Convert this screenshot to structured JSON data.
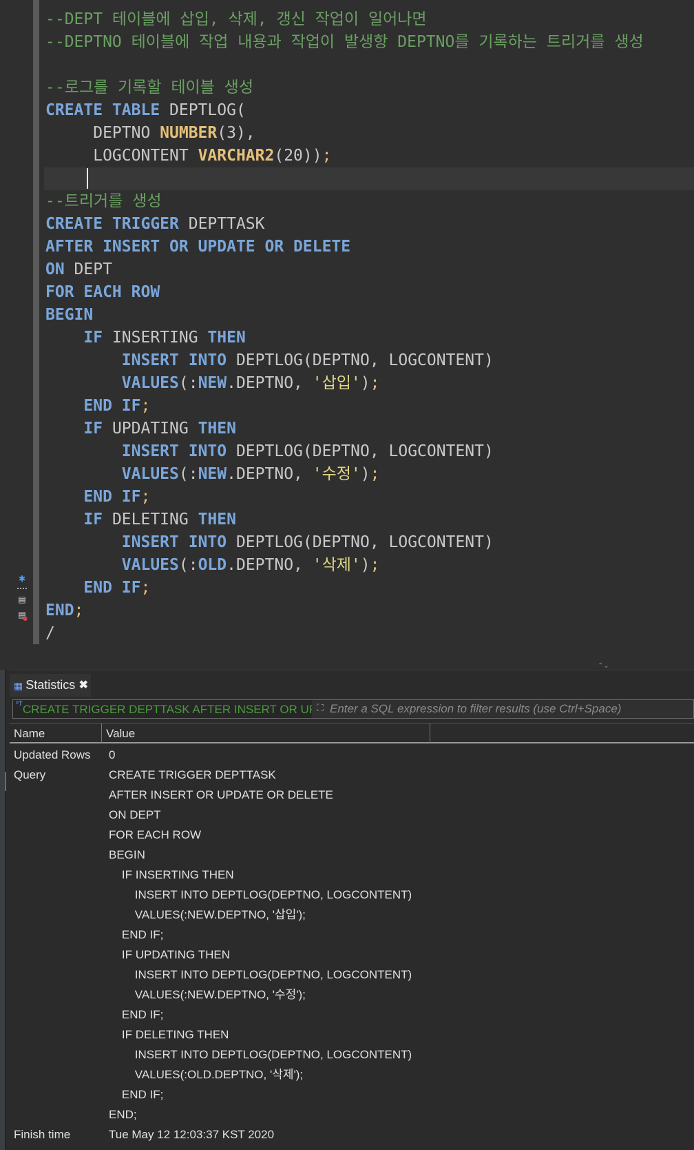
{
  "editor": {
    "lines": [
      {
        "segs": [
          {
            "t": "--DEPT 테이블에 삽입, 삭제, 갱신 작업이 일어나면",
            "c": "cm"
          }
        ]
      },
      {
        "segs": [
          {
            "t": "--DEPTNO 테이블에 작업 내용과 작업이 발생항 DEPTNO를 기록하는 트리거를 생성",
            "c": "cm"
          }
        ]
      },
      {
        "segs": [
          {
            "t": "",
            "c": "id"
          }
        ]
      },
      {
        "segs": [
          {
            "t": "--로그를 기록할 테이블 생성",
            "c": "cm"
          }
        ]
      },
      {
        "segs": [
          {
            "t": "CREATE TABLE",
            "c": "kw"
          },
          {
            "t": " DEPTLOG(",
            "c": "id"
          }
        ]
      },
      {
        "segs": [
          {
            "t": "     DEPTNO ",
            "c": "id"
          },
          {
            "t": "NUMBER",
            "c": "ty"
          },
          {
            "t": "(3),",
            "c": "id"
          }
        ]
      },
      {
        "segs": [
          {
            "t": "     LOGCONTENT ",
            "c": "id"
          },
          {
            "t": "VARCHAR2",
            "c": "ty"
          },
          {
            "t": "(20))",
            "c": "id"
          },
          {
            "t": ";",
            "c": "pu"
          }
        ]
      },
      {
        "segs": [
          {
            "t": "",
            "c": "id"
          }
        ],
        "current": true
      },
      {
        "segs": [
          {
            "t": "--트리거를 생성",
            "c": "cm"
          }
        ]
      },
      {
        "segs": [
          {
            "t": "CREATE TRIGGER",
            "c": "kw"
          },
          {
            "t": " DEPTTASK",
            "c": "id"
          }
        ]
      },
      {
        "segs": [
          {
            "t": "AFTER INSERT OR UPDATE OR DELETE",
            "c": "kw"
          }
        ]
      },
      {
        "segs": [
          {
            "t": "ON",
            "c": "kw"
          },
          {
            "t": " DEPT",
            "c": "id"
          }
        ]
      },
      {
        "segs": [
          {
            "t": "FOR EACH ROW",
            "c": "kw"
          }
        ]
      },
      {
        "segs": [
          {
            "t": "BEGIN",
            "c": "kw"
          }
        ]
      },
      {
        "segs": [
          {
            "t": "    ",
            "c": "id"
          },
          {
            "t": "IF",
            "c": "kw"
          },
          {
            "t": " INSERTING ",
            "c": "id"
          },
          {
            "t": "THEN",
            "c": "kw"
          }
        ]
      },
      {
        "segs": [
          {
            "t": "        ",
            "c": "id"
          },
          {
            "t": "INSERT INTO",
            "c": "kw"
          },
          {
            "t": " DEPTLOG(DEPTNO, LOGCONTENT)",
            "c": "id"
          }
        ]
      },
      {
        "segs": [
          {
            "t": "        ",
            "c": "id"
          },
          {
            "t": "VALUES",
            "c": "kw"
          },
          {
            "t": "(:",
            "c": "id"
          },
          {
            "t": "NEW",
            "c": "kw"
          },
          {
            "t": ".DEPTNO, ",
            "c": "id"
          },
          {
            "t": "'삽입'",
            "c": "st"
          },
          {
            "t": ")",
            "c": "id"
          },
          {
            "t": ";",
            "c": "pu"
          }
        ]
      },
      {
        "segs": [
          {
            "t": "    ",
            "c": "id"
          },
          {
            "t": "END IF",
            "c": "kw"
          },
          {
            "t": ";",
            "c": "pu"
          }
        ]
      },
      {
        "segs": [
          {
            "t": "    ",
            "c": "id"
          },
          {
            "t": "IF",
            "c": "kw"
          },
          {
            "t": " UPDATING ",
            "c": "id"
          },
          {
            "t": "THEN",
            "c": "kw"
          }
        ]
      },
      {
        "segs": [
          {
            "t": "        ",
            "c": "id"
          },
          {
            "t": "INSERT INTO",
            "c": "kw"
          },
          {
            "t": " DEPTLOG(DEPTNO, LOGCONTENT)",
            "c": "id"
          }
        ]
      },
      {
        "segs": [
          {
            "t": "        ",
            "c": "id"
          },
          {
            "t": "VALUES",
            "c": "kw"
          },
          {
            "t": "(:",
            "c": "id"
          },
          {
            "t": "NEW",
            "c": "kw"
          },
          {
            "t": ".DEPTNO, ",
            "c": "id"
          },
          {
            "t": "'수정'",
            "c": "st"
          },
          {
            "t": ")",
            "c": "id"
          },
          {
            "t": ";",
            "c": "pu"
          }
        ]
      },
      {
        "segs": [
          {
            "t": "    ",
            "c": "id"
          },
          {
            "t": "END IF",
            "c": "kw"
          },
          {
            "t": ";",
            "c": "pu"
          }
        ]
      },
      {
        "segs": [
          {
            "t": "    ",
            "c": "id"
          },
          {
            "t": "IF",
            "c": "kw"
          },
          {
            "t": " DELETING ",
            "c": "id"
          },
          {
            "t": "THEN",
            "c": "kw"
          }
        ]
      },
      {
        "segs": [
          {
            "t": "        ",
            "c": "id"
          },
          {
            "t": "INSERT INTO",
            "c": "kw"
          },
          {
            "t": " DEPTLOG(DEPTNO, LOGCONTENT)",
            "c": "id"
          }
        ]
      },
      {
        "segs": [
          {
            "t": "        ",
            "c": "id"
          },
          {
            "t": "VALUES",
            "c": "kw"
          },
          {
            "t": "(:",
            "c": "id"
          },
          {
            "t": "OLD",
            "c": "kw"
          },
          {
            "t": ".DEPTNO, ",
            "c": "id"
          },
          {
            "t": "'삭제'",
            "c": "st"
          },
          {
            "t": ")",
            "c": "id"
          },
          {
            "t": ";",
            "c": "pu"
          }
        ]
      },
      {
        "segs": [
          {
            "t": "    ",
            "c": "id"
          },
          {
            "t": "END IF",
            "c": "kw"
          },
          {
            "t": ";",
            "c": "pu"
          }
        ]
      },
      {
        "segs": [
          {
            "t": "END",
            "c": "kw"
          },
          {
            "t": ";",
            "c": "pu"
          }
        ]
      },
      {
        "segs": [
          {
            "t": "/",
            "c": "id"
          }
        ]
      }
    ],
    "gutter_icons": [
      "settings-icon",
      "script-icon",
      "script-error-icon"
    ]
  },
  "panel": {
    "tab_label": "Statistics",
    "tab_close": "✖",
    "filter_query_text": "CREATE TRIGGER DEPTTASK AFTER INSERT OR UPDATE OR DELETE",
    "filter_placeholder": "Enter a SQL expression to filter results (use Ctrl+Space)",
    "columns": [
      "Name",
      "Value"
    ],
    "updated_rows_label": "Updated Rows",
    "updated_rows_value": "0",
    "query_label": "Query",
    "query_lines": [
      "CREATE TRIGGER DEPTTASK",
      "AFTER INSERT OR UPDATE OR DELETE",
      "ON DEPT",
      "FOR EACH ROW",
      "BEGIN",
      "    IF INSERTING THEN",
      "        INSERT INTO DEPTLOG(DEPTNO, LOGCONTENT)",
      "        VALUES(:NEW.DEPTNO, '삽입');",
      "    END IF;",
      "    IF UPDATING THEN",
      "        INSERT INTO DEPTLOG(DEPTNO, LOGCONTENT)",
      "        VALUES(:NEW.DEPTNO, '수정');",
      "    END IF;",
      "    IF DELETING THEN",
      "        INSERT INTO DEPTLOG(DEPTNO, LOGCONTENT)",
      "        VALUES(:OLD.DEPTNO, '삭제');",
      "    END IF;",
      "END;"
    ],
    "finish_time_label": "Finish time",
    "finish_time_value": "Tue May 12 12:03:37 KST 2020"
  },
  "colors": {
    "keyword": "#7aa6da",
    "type": "#e5c07b",
    "comment": "#6a9f62",
    "string": "#e0d685",
    "identifier": "#c8c8c8"
  }
}
